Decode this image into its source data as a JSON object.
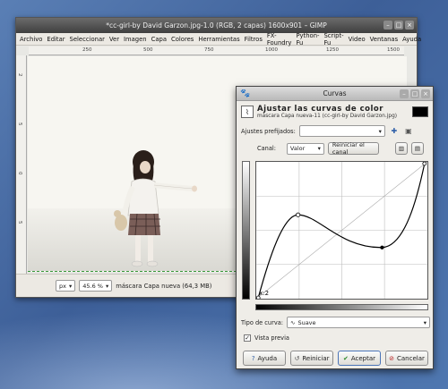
{
  "gimp": {
    "title": "*cc-girl-by David Garzon.jpg-1.0 (RGB, 2 capas) 1600x901 – GIMP",
    "menu": [
      "Archivo",
      "Editar",
      "Seleccionar",
      "Ver",
      "Imagen",
      "Capa",
      "Colores",
      "Herramientas",
      "Filtros",
      "FX-Foundry",
      "Python-Fu",
      "Script-Fu",
      "Video",
      "Ventanas",
      "Ayuda"
    ],
    "ruler_h": [
      "250",
      "500",
      "750",
      "1000",
      "1250",
      "1500"
    ],
    "ruler_v": [
      "2",
      "5",
      "0",
      "5"
    ],
    "status": {
      "unit": "px",
      "zoom": "45.6 %",
      "layer": "máscara Capa nueva (64,3 MB)"
    }
  },
  "curves": {
    "window_title": "Curvas",
    "heading": "Ajustar las curvas de color",
    "subheading": "máscara Capa nueva-11 (cc-girl-by David Garzon.jpg)",
    "presets_label": "Ajustes prefijados:",
    "channel_label": "Canal:",
    "channel_value": "Valor",
    "reset_channel": "Reiniciar el canal",
    "point_label": "x:2",
    "curve_type_label": "Tipo de curva:",
    "curve_type_value": "Suave",
    "preview_label": "Vista previa",
    "preview_checked": true,
    "buttons": {
      "help": "Ayuda",
      "reset": "Reiniciar",
      "ok": "Aceptar",
      "cancel": "Cancelar"
    }
  },
  "icons": [
    "gimp-icon",
    "minimize-icon",
    "maximize-icon",
    "close-icon",
    "curves-icon",
    "add-preset-icon",
    "preset-menu-icon",
    "linear-histogram-icon",
    "log-histogram-icon",
    "smooth-curve-icon",
    "help-icon",
    "reset-icon",
    "ok-icon",
    "cancel-icon"
  ]
}
